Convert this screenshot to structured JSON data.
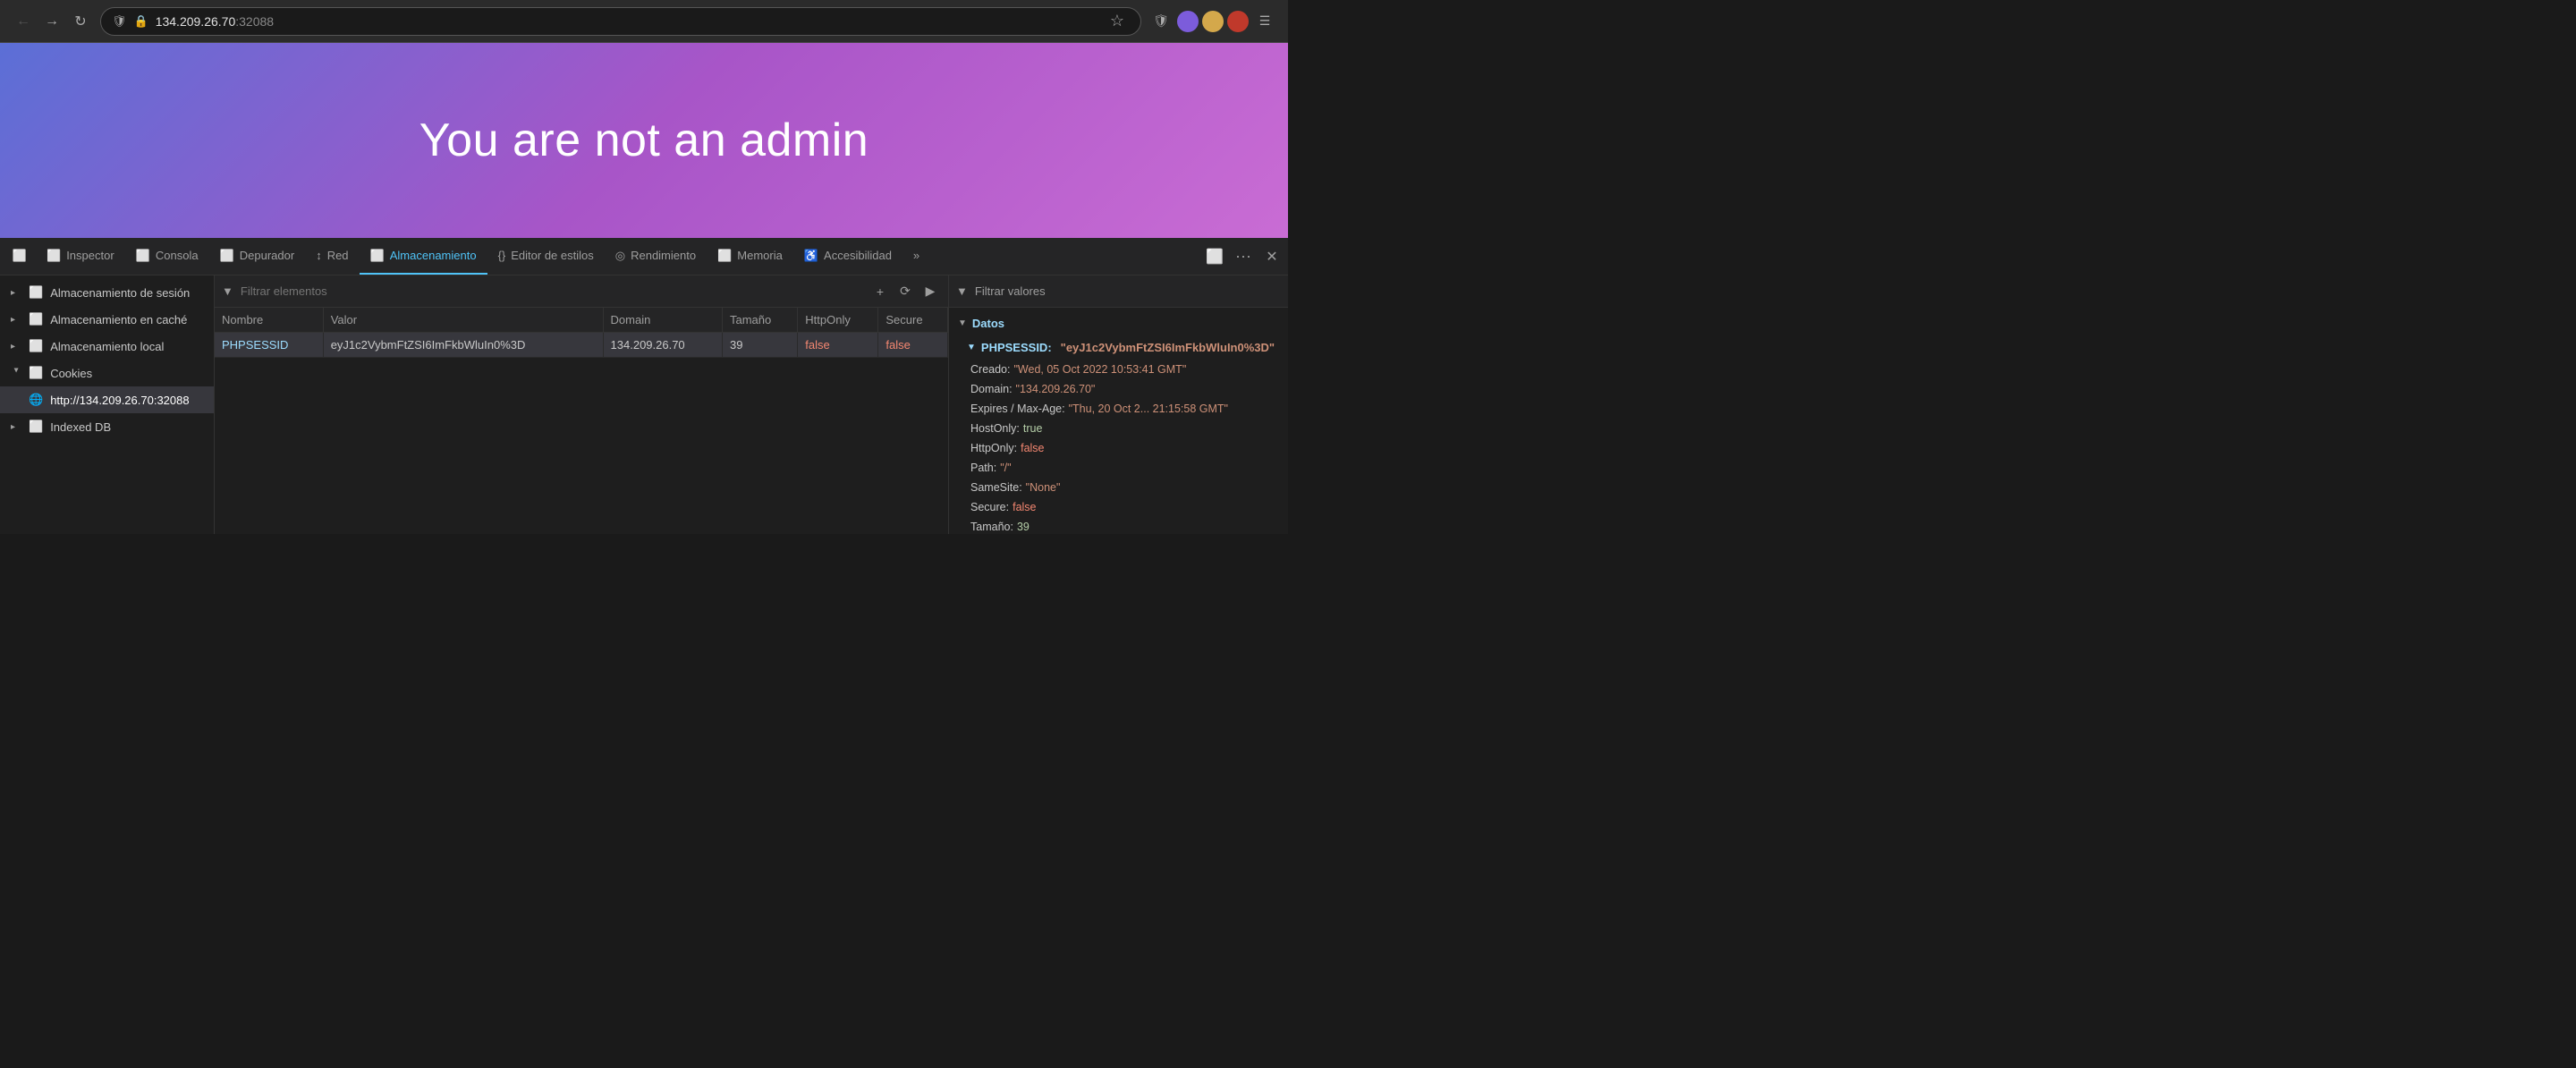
{
  "browser": {
    "url": {
      "host": "134.209.26.70",
      "port": ":32088"
    },
    "title": "134.209.26.70:32088"
  },
  "page": {
    "heading": "You are not an admin"
  },
  "devtools": {
    "tabs": [
      {
        "id": "inspector",
        "label": "Inspector",
        "icon": "🔍",
        "active": false
      },
      {
        "id": "consola",
        "label": "Consola",
        "icon": "⬜",
        "active": false
      },
      {
        "id": "depurador",
        "label": "Depurador",
        "icon": "⬜",
        "active": false
      },
      {
        "id": "red",
        "label": "Red",
        "icon": "↕",
        "active": false
      },
      {
        "id": "almacenamiento",
        "label": "Almacenamiento",
        "icon": "⬜",
        "active": true
      },
      {
        "id": "editor-estilos",
        "label": "Editor de estilos",
        "icon": "{}",
        "active": false
      },
      {
        "id": "rendimiento",
        "label": "Rendimiento",
        "icon": "◎",
        "active": false
      },
      {
        "id": "memoria",
        "label": "Memoria",
        "icon": "⬜",
        "active": false
      },
      {
        "id": "accesibilidad",
        "label": "Accesibilidad",
        "icon": "♿",
        "active": false
      }
    ],
    "sidebar": {
      "items": [
        {
          "id": "almacenamiento-sesion",
          "label": "Almacenamiento de sesión",
          "expanded": false,
          "selected": false,
          "isChild": false
        },
        {
          "id": "almacenamiento-cache",
          "label": "Almacenamiento en caché",
          "expanded": false,
          "selected": false,
          "isChild": false
        },
        {
          "id": "almacenamiento-local",
          "label": "Almacenamiento local",
          "expanded": false,
          "selected": false,
          "isChild": false
        },
        {
          "id": "cookies",
          "label": "Cookies",
          "expanded": true,
          "selected": false,
          "isChild": false
        },
        {
          "id": "cookies-url",
          "label": "http://134.209.26.70:32088",
          "expanded": false,
          "selected": true,
          "isChild": true
        },
        {
          "id": "indexed-db",
          "label": "Indexed DB",
          "expanded": false,
          "selected": false,
          "isChild": false
        }
      ]
    },
    "filter": {
      "placeholder": "Filtrar elementos"
    },
    "table": {
      "headers": [
        "Nombre",
        "Valor",
        "Domain",
        "Tamaño",
        "HttpOnly",
        "Secure"
      ],
      "rows": [
        {
          "nombre": "PHPSESSID",
          "valor": "eyJ1c2VybmFtZSI6ImFkbWluIn0%3D",
          "domain": "134.209.26.70",
          "tamano": "39",
          "httpOnly": "false",
          "secure": "false"
        }
      ]
    },
    "details": {
      "filter_placeholder": "Filtrar valores",
      "section_label": "Datos",
      "cookie_name": "PHPSESSID",
      "fields": [
        {
          "key": "PHPSESSID:",
          "value": "\"eyJ1c2VybmFtZSI6ImFkbWluIn0%3D\"",
          "type": "string"
        },
        {
          "key": "Creado:",
          "value": "\"Wed, 05 Oct 2022 10:53:41 GMT\"",
          "type": "string"
        },
        {
          "key": "Domain:",
          "value": "\"134.209.26.70\"",
          "type": "string"
        },
        {
          "key": "Expires / Max-Age:",
          "value": "\"Thu, 20 Oct 2... 21:15:58 GMT\"",
          "type": "string"
        },
        {
          "key": "HostOnly:",
          "value": "true",
          "type": "true"
        },
        {
          "key": "HttpOnly:",
          "value": "false",
          "type": "false"
        },
        {
          "key": "Path:",
          "value": "\"/\"",
          "type": "string"
        },
        {
          "key": "SameSite:",
          "value": "\"None\"",
          "type": "string"
        },
        {
          "key": "Secure:",
          "value": "false",
          "type": "false"
        },
        {
          "key": "Tamaño:",
          "value": "39",
          "type": "number"
        }
      ]
    }
  }
}
